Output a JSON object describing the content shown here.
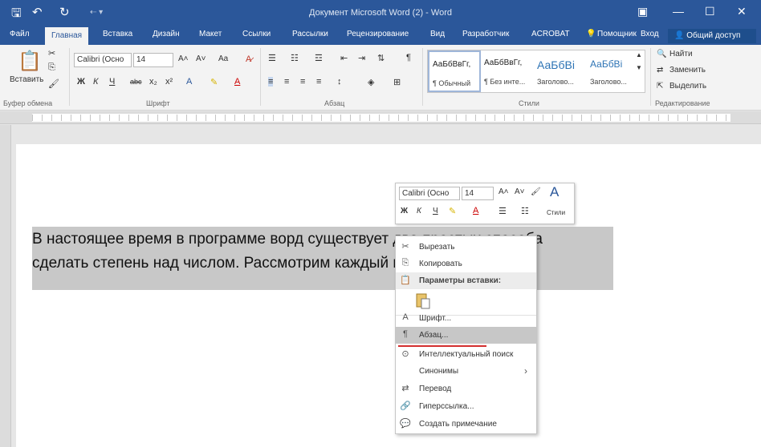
{
  "window": {
    "title": "Документ Microsoft Word (2) - Word",
    "quick_access": [
      "save-icon",
      "undo-icon",
      "redo-icon",
      "customize-icon"
    ],
    "controls": {
      "ribbon_display": "▣",
      "minimize": "—",
      "maximize": "☐",
      "close": "✕"
    }
  },
  "tabs": [
    "Файл",
    "Главная",
    "Вставка",
    "Дизайн",
    "Макет",
    "Ссылки",
    "Рассылки",
    "Рецензирование",
    "Вид",
    "Разработчик",
    "ACROBAT"
  ],
  "tell_me": "Помощник",
  "signin": "Вход",
  "share": "Общий доступ",
  "ribbon": {
    "clipboard": {
      "paste_label": "Вставить",
      "group_label": "Буфер обмена"
    },
    "font": {
      "font_name": "Calibri (Осно",
      "font_size": "14",
      "group_label": "Шрифт",
      "bold": "Ж",
      "italic": "К",
      "underline": "Ч",
      "strike": "abc",
      "sub": "x₂",
      "sup": "x²",
      "grow": "A˄",
      "shrink": "A˅",
      "case": "Aa"
    },
    "paragraph": {
      "group_label": "Абзац"
    },
    "styles": {
      "group_label": "Стили",
      "items": [
        {
          "preview": "АаБбВвГг,",
          "name": "¶ Обычный"
        },
        {
          "preview": "АаБбВвГг,",
          "name": "¶ Без инте..."
        },
        {
          "preview": "АаБбВі",
          "name": "Заголово..."
        },
        {
          "preview": "АаБбВі",
          "name": "Заголово..."
        }
      ]
    },
    "editing": {
      "group_label": "Редактирование",
      "find": "Найти",
      "replace": "Заменить",
      "select": "Выделить"
    }
  },
  "document": {
    "line1": "В настоящее время в программе ворд существует два простых способа",
    "line2": "сделать степень над числом. Рассмотрим каждый подробнее."
  },
  "mini_toolbar": {
    "font_name": "Calibri (Осно",
    "font_size": "14",
    "styles": "Стили",
    "bold": "Ж",
    "italic": "К",
    "underline": "Ч"
  },
  "context_menu": {
    "items": [
      {
        "label": "Вырезать",
        "icon": "✂"
      },
      {
        "label": "Копировать",
        "icon": "⎘"
      },
      {
        "label": "Параметры вставки:",
        "icon": "📋"
      },
      {
        "label": "Шрифт...",
        "icon": "A"
      },
      {
        "label": "Абзац...",
        "icon": "¶"
      },
      {
        "label": "Интеллектуальный поиск",
        "icon": "⊙"
      },
      {
        "label": "Синонимы",
        "icon": "",
        "submenu": "›"
      },
      {
        "label": "Перевод",
        "icon": "⇄"
      },
      {
        "label": "Гиперссылка...",
        "icon": "🔗"
      },
      {
        "label": "Создать примечание",
        "icon": "💬"
      }
    ]
  }
}
